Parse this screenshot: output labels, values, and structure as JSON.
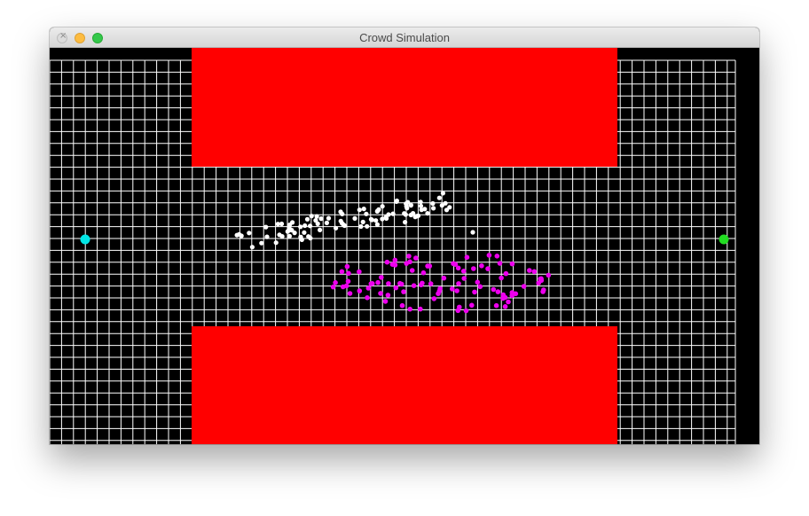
{
  "window": {
    "title": "Crowd Simulation"
  },
  "colors": {
    "background": "#000000",
    "grid": "#ffffff",
    "obstacle": "#ff0000",
    "goal_left": "#00e5e5",
    "goal_right": "#22dd22",
    "agent_group_a": "#ffffff",
    "agent_group_b": "#ee00ee"
  },
  "icons": {
    "close": "close-icon",
    "minimize": "minimize-icon",
    "maximize": "maximize-icon"
  }
}
